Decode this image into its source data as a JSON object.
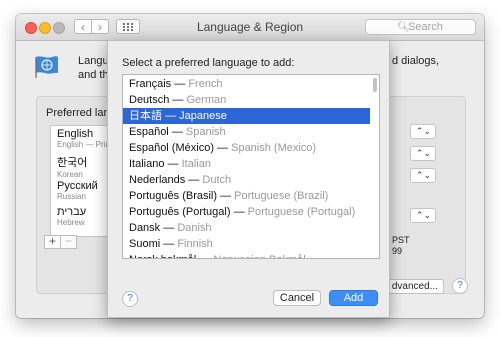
{
  "window": {
    "title": "Language & Region",
    "search_placeholder": "Search",
    "nav_back_glyph": "‹",
    "nav_fwd_glyph": "›"
  },
  "background": {
    "desc_fragment_1": "Langua",
    "desc_fragment_2": "and the",
    "desc_right": "d dialogs,",
    "preferred_label": "Preferred langu",
    "languages": [
      {
        "name": "English",
        "sub": "English — Prim"
      },
      {
        "name": "한국어",
        "sub": "Korean"
      },
      {
        "name": "Русский",
        "sub": "Russian"
      },
      {
        "name": "עברית",
        "sub": "Hebrew"
      }
    ],
    "add_glyph": "+",
    "remove_glyph": "−",
    "popup_chevron": "⌃⌄",
    "time_fragment": "PST",
    "number_fragment": "99",
    "advanced_label": "dvanced...",
    "help_glyph": "?"
  },
  "sheet": {
    "title": "Select a preferred language to add:",
    "languages": [
      {
        "native": "Français",
        "english": "French",
        "selected": false
      },
      {
        "native": "Deutsch",
        "english": "German",
        "selected": false
      },
      {
        "native": "日本語",
        "english": "Japanese",
        "selected": true
      },
      {
        "native": "Español",
        "english": "Spanish",
        "selected": false
      },
      {
        "native": "Español (México)",
        "english": "Spanish (Mexico)",
        "selected": false
      },
      {
        "native": "Italiano",
        "english": "Italian",
        "selected": false
      },
      {
        "native": "Nederlands",
        "english": "Dutch",
        "selected": false
      },
      {
        "native": "Português (Brasil)",
        "english": "Portuguese (Brazil)",
        "selected": false
      },
      {
        "native": "Português (Portugal)",
        "english": "Portuguese (Portugal)",
        "selected": false
      },
      {
        "native": "Dansk",
        "english": "Danish",
        "selected": false
      },
      {
        "native": "Suomi",
        "english": "Finnish",
        "selected": false
      },
      {
        "native": "Norsk bokmål",
        "english": "Norwegian Bokmål",
        "selected": false
      }
    ],
    "dash": "—",
    "help_glyph": "?",
    "cancel_label": "Cancel",
    "add_label": "Add"
  },
  "colors": {
    "selection": "#2b67d7",
    "primary_button": "#3e8df6",
    "close": "#fc5f57",
    "minimize": "#fdbc2e"
  }
}
